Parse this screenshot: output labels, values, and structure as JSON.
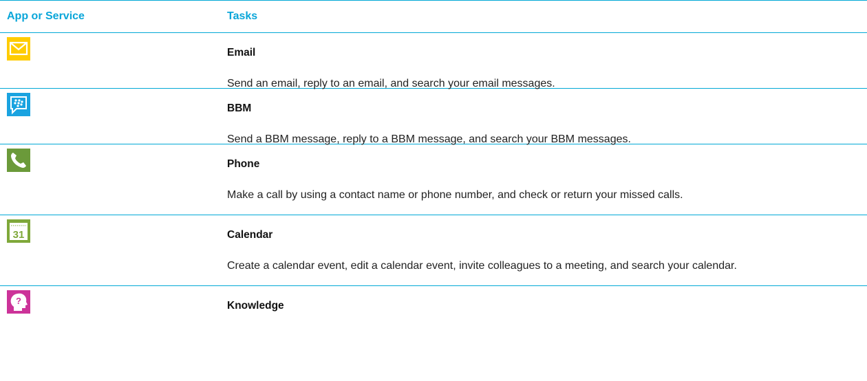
{
  "header": {
    "app_label": "App or Service",
    "tasks_label": "Tasks"
  },
  "rows": [
    {
      "icon": "email-icon",
      "title": "Email",
      "description": "Send an email, reply to an email, and search your email messages."
    },
    {
      "icon": "bbm-icon",
      "title": "BBM",
      "description": "Send a BBM message, reply to a BBM message, and search your BBM messages."
    },
    {
      "icon": "phone-icon",
      "title": "Phone",
      "description": "Make a call by using a contact name or phone number, and check or return your missed calls."
    },
    {
      "icon": "calendar-icon",
      "title": "Calendar",
      "icon_text": "31",
      "description": "Create a calendar event, edit a calendar event, invite colleagues to a meeting, and search your calendar."
    },
    {
      "icon": "knowledge-icon",
      "title": "Knowledge",
      "icon_text": "?"
    }
  ],
  "colors": {
    "accent": "#0aa6d9",
    "email": "#ffcc00",
    "bbm": "#1aa3e0",
    "phone": "#6b9a3a",
    "calendar": "#7fa83a",
    "knowledge": "#cc3399"
  }
}
